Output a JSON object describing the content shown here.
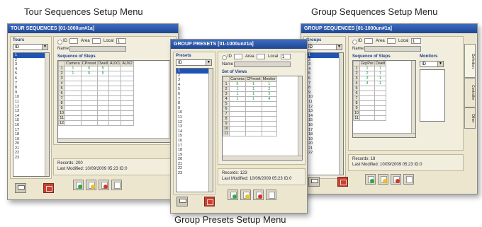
{
  "captions": {
    "tour": "Tour Sequences Setup Menu",
    "group": "Group Sequences Setup Menu",
    "presets": "Group Presets Setup Menu"
  },
  "tour_window": {
    "title": "TOUR SEQUENCES   [01-1000un#1a]",
    "list_title": "Tours",
    "select_value": "ID",
    "id_label": "ID",
    "area_label": "Area",
    "local_label": "Local",
    "local_value": "1",
    "name_label": "Name",
    "section": "Sequence of Steps",
    "columns": [
      "Camera",
      "CPreset",
      "Dwell",
      "AUX1",
      "AUX2"
    ],
    "rows": [
      [
        "1",
        "1",
        "0",
        "5",
        "",
        ""
      ],
      [
        "2",
        "1",
        "0",
        "5",
        "",
        ""
      ],
      [
        "3",
        "",
        "",
        "",
        "",
        ""
      ],
      [
        "4",
        "",
        "",
        "",
        "",
        ""
      ],
      [
        "5",
        "",
        "",
        "",
        "",
        ""
      ],
      [
        "6",
        "",
        "",
        "",
        "",
        ""
      ],
      [
        "7",
        "",
        "",
        "",
        "",
        ""
      ],
      [
        "8",
        "",
        "",
        "",
        "",
        ""
      ],
      [
        "9",
        "",
        "",
        "",
        "",
        ""
      ],
      [
        "10",
        "",
        "",
        "",
        "",
        ""
      ],
      [
        "11",
        "",
        "",
        "",
        "",
        ""
      ],
      [
        "12",
        "",
        "",
        "",
        "",
        ""
      ]
    ],
    "items": [
      "1",
      "2",
      "3",
      "4",
      "5",
      "6",
      "7",
      "8",
      "9",
      "10",
      "11",
      "12",
      "13",
      "14",
      "15",
      "16",
      "17",
      "18",
      "19",
      "20",
      "21",
      "22",
      "23"
    ],
    "records": "Records:  200",
    "modified": "Last Modified:  10/09/2009 05:23 ID:0"
  },
  "presets_window": {
    "title": "GROUP PRESETS   [01-1000un#1a]",
    "list_title": "Presets",
    "select_value": "ID",
    "id_label": "ID",
    "area_label": "Area",
    "local_label": "Local",
    "local_value": "1",
    "name_label": "Name",
    "section": "Set of Views",
    "columns": [
      "Camera",
      "CPreset",
      "Monitor"
    ],
    "rows": [
      [
        "1",
        "5",
        "1",
        "1"
      ],
      [
        "2",
        "1",
        "1",
        "2"
      ],
      [
        "3",
        "1",
        "1",
        "3"
      ],
      [
        "4",
        "1",
        "1",
        "4"
      ],
      [
        "5",
        "",
        "",
        ""
      ],
      [
        "6",
        "",
        "",
        ""
      ],
      [
        "7",
        "",
        "",
        ""
      ],
      [
        "8",
        "",
        "",
        ""
      ],
      [
        "9",
        "",
        "",
        ""
      ],
      [
        "10",
        "",
        "",
        ""
      ],
      [
        "11",
        "",
        "",
        ""
      ]
    ],
    "items": [
      "1",
      "2",
      "3",
      "4",
      "5",
      "6",
      "7",
      "8",
      "9",
      "10",
      "11",
      "12",
      "13",
      "14",
      "15",
      "16",
      "17",
      "18",
      "19",
      "20",
      "21",
      "22",
      "23"
    ],
    "records": "Records:  123",
    "modified": "Last Modified:  10/09/2009 05:23 ID:0"
  },
  "group_window": {
    "title": "GROUP SEQUENCES   [01-1000un#1a]",
    "list_title": "Groups",
    "select_value": "ID",
    "id_label": "ID",
    "area_label": "Area",
    "local_label": "Local",
    "local_value": "1",
    "name_label": "Name",
    "section": "Sequence of Steps",
    "monitors_label": "Monitors",
    "monitors_select": "ID",
    "columns": [
      "GrpPre",
      "Dwell"
    ],
    "rows": [
      [
        "1",
        "1",
        "1"
      ],
      [
        "2",
        "2",
        "1"
      ],
      [
        "3",
        "3",
        "1"
      ],
      [
        "4",
        "4",
        "1"
      ],
      [
        "5",
        "",
        ""
      ],
      [
        "6",
        "",
        ""
      ],
      [
        "7",
        "",
        ""
      ],
      [
        "8",
        "",
        ""
      ],
      [
        "9",
        "",
        ""
      ],
      [
        "10",
        "",
        ""
      ],
      [
        "11",
        "",
        ""
      ]
    ],
    "items": [
      "1",
      "2",
      "3",
      "4",
      "5",
      "6",
      "7",
      "8",
      "9",
      "10",
      "11",
      "12",
      "13",
      "14",
      "15",
      "16",
      "17",
      "18",
      "19",
      "20",
      "21",
      "22"
    ],
    "records": "Records:  18",
    "modified": "Last Modified:  10/09/2009 05:23 ID:0",
    "tabs": [
      "Definition",
      "Controller",
      "Other"
    ]
  },
  "colors": {
    "title_bar": "#2a55a8",
    "selected": "#1f54b7",
    "cell_value": "#159640",
    "background": "#ece6cf"
  },
  "icons": [
    "printer-icon",
    "close-icon",
    "new-record-icon",
    "edit-record-icon",
    "delete-record-icon",
    "report-icon"
  ]
}
